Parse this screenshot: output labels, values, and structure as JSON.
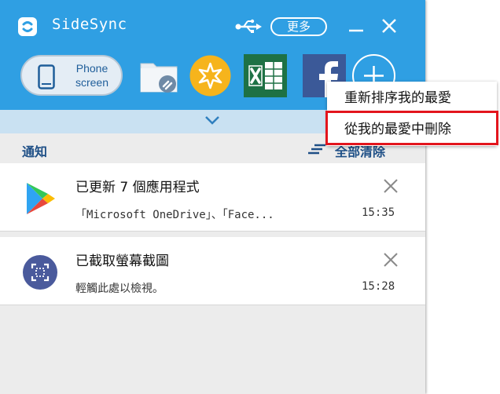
{
  "app": {
    "title": "SideSync",
    "more_label": "更多",
    "icons": {
      "logo": "sidesync-logo-icon",
      "usb": "usb-icon",
      "minimize": "minimize-icon",
      "close": "close-icon"
    }
  },
  "toolbar": {
    "phone_screen_label": "Phone screen",
    "favorites": [
      {
        "name": "folder-app-icon"
      },
      {
        "name": "star-app-icon",
        "color": "#f6b41c"
      },
      {
        "name": "excel-app-icon",
        "color": "#1e7145"
      },
      {
        "name": "facebook-app-icon",
        "color": "#3b5998"
      }
    ],
    "add_icon": "plus-icon"
  },
  "notifications": {
    "title": "通知",
    "clear_all_label": "全部清除",
    "items": [
      {
        "icon": "play-store-icon",
        "title": "已更新 7 個應用程式",
        "text": "「Microsoft OneDrive」、「Face...",
        "time": "15:35"
      },
      {
        "icon": "screenshot-icon",
        "title": "已截取螢幕截圖",
        "text": "輕觸此處以檢視。",
        "time": "15:28"
      }
    ]
  },
  "context_menu": {
    "items": [
      {
        "label": "重新排序我的最愛"
      },
      {
        "label": "從我的最愛中刪除",
        "highlighted": true
      }
    ]
  },
  "colors": {
    "accent": "#2f9fe3",
    "highlight_box": "#e3151d",
    "header_text": "#1e4f86"
  }
}
